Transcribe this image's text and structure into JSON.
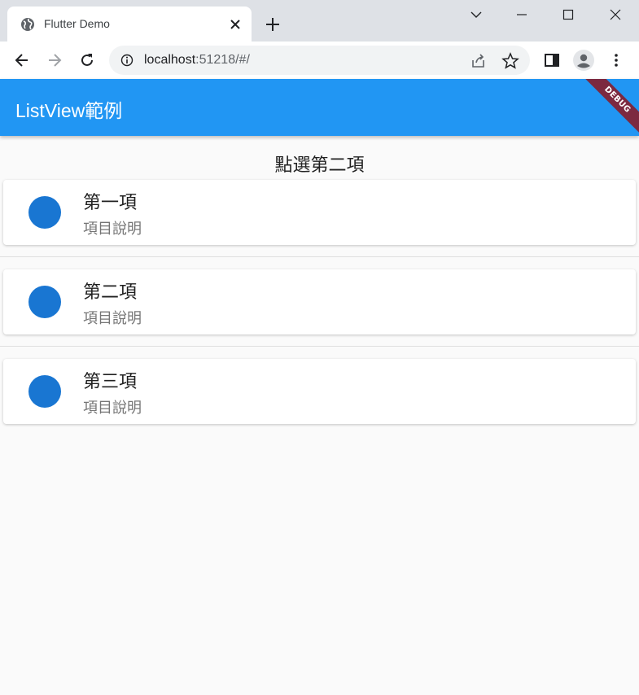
{
  "browser": {
    "tab_title": "Flutter Demo",
    "url_host": "localhost",
    "url_rest": ":51218/#/"
  },
  "app": {
    "title": "ListView範例",
    "debug_label": "DEBUG",
    "selected_text": "點選第二項",
    "items": [
      {
        "title": "第一項",
        "subtitle": "項目說明"
      },
      {
        "title": "第二項",
        "subtitle": "項目說明"
      },
      {
        "title": "第三項",
        "subtitle": "項目說明"
      }
    ]
  },
  "colors": {
    "appbar": "#2196f3",
    "avatar": "#1976d2",
    "debug_banner": "#7c2940"
  },
  "icons": [
    "globe-icon",
    "close-icon",
    "plus-icon",
    "chevron-down-icon",
    "minimize-icon",
    "maximize-icon",
    "close-window-icon",
    "back-arrow-icon",
    "forward-arrow-icon",
    "reload-icon",
    "info-icon",
    "share-icon",
    "star-icon",
    "side-panel-icon",
    "profile-icon",
    "more-vert-icon"
  ]
}
